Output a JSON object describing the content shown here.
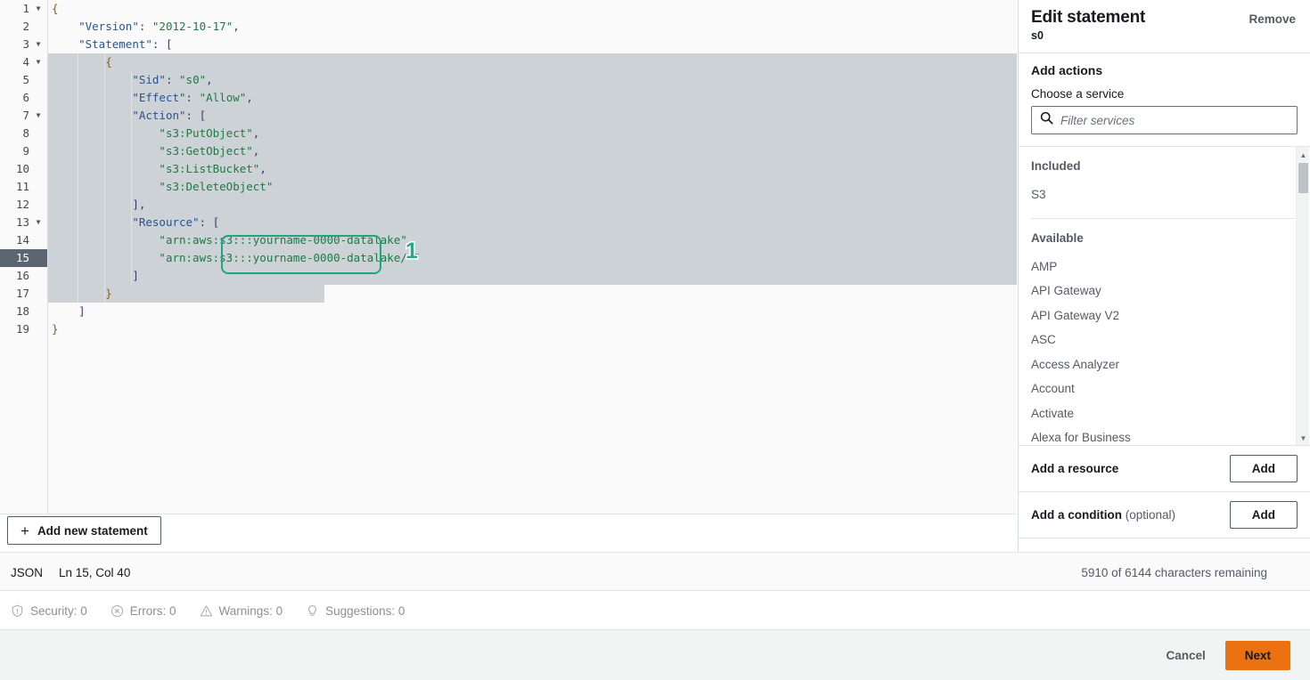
{
  "editor": {
    "language": "JSON",
    "cursor": "Ln 15, Col 40",
    "active_line": 15,
    "lines": [
      {
        "n": 1,
        "fold": true,
        "tokens": [
          {
            "t": "brace",
            "v": "{"
          }
        ]
      },
      {
        "n": 2,
        "fold": false,
        "tokens": [
          {
            "t": "plain",
            "v": "    "
          },
          {
            "t": "key",
            "v": "\"Version\""
          },
          {
            "t": "pun",
            "v": ": "
          },
          {
            "t": "str",
            "v": "\"2012-10-17\""
          },
          {
            "t": "pun",
            "v": ","
          }
        ]
      },
      {
        "n": 3,
        "fold": true,
        "tokens": [
          {
            "t": "plain",
            "v": "    "
          },
          {
            "t": "key",
            "v": "\"Statement\""
          },
          {
            "t": "pun",
            "v": ": ["
          }
        ]
      },
      {
        "n": 4,
        "fold": true,
        "tokens": [
          {
            "t": "plain",
            "v": "        "
          },
          {
            "t": "brace",
            "v": "{"
          }
        ]
      },
      {
        "n": 5,
        "fold": false,
        "tokens": [
          {
            "t": "plain",
            "v": "            "
          },
          {
            "t": "key",
            "v": "\"Sid\""
          },
          {
            "t": "pun",
            "v": ": "
          },
          {
            "t": "str",
            "v": "\"s0\""
          },
          {
            "t": "pun",
            "v": ","
          }
        ]
      },
      {
        "n": 6,
        "fold": false,
        "tokens": [
          {
            "t": "plain",
            "v": "            "
          },
          {
            "t": "key",
            "v": "\"Effect\""
          },
          {
            "t": "pun",
            "v": ": "
          },
          {
            "t": "str",
            "v": "\"Allow\""
          },
          {
            "t": "pun",
            "v": ","
          }
        ]
      },
      {
        "n": 7,
        "fold": true,
        "tokens": [
          {
            "t": "plain",
            "v": "            "
          },
          {
            "t": "key",
            "v": "\"Action\""
          },
          {
            "t": "pun",
            "v": ": ["
          }
        ]
      },
      {
        "n": 8,
        "fold": false,
        "tokens": [
          {
            "t": "plain",
            "v": "                "
          },
          {
            "t": "str",
            "v": "\"s3:PutObject\""
          },
          {
            "t": "pun",
            "v": ","
          }
        ]
      },
      {
        "n": 9,
        "fold": false,
        "tokens": [
          {
            "t": "plain",
            "v": "                "
          },
          {
            "t": "str",
            "v": "\"s3:GetObject\""
          },
          {
            "t": "pun",
            "v": ","
          }
        ]
      },
      {
        "n": 10,
        "fold": false,
        "tokens": [
          {
            "t": "plain",
            "v": "                "
          },
          {
            "t": "str",
            "v": "\"s3:ListBucket\""
          },
          {
            "t": "pun",
            "v": ","
          }
        ]
      },
      {
        "n": 11,
        "fold": false,
        "tokens": [
          {
            "t": "plain",
            "v": "                "
          },
          {
            "t": "str",
            "v": "\"s3:DeleteObject\""
          }
        ]
      },
      {
        "n": 12,
        "fold": false,
        "tokens": [
          {
            "t": "plain",
            "v": "            "
          },
          {
            "t": "pun",
            "v": "],"
          }
        ]
      },
      {
        "n": 13,
        "fold": true,
        "tokens": [
          {
            "t": "plain",
            "v": "            "
          },
          {
            "t": "key",
            "v": "\"Resource\""
          },
          {
            "t": "pun",
            "v": ": ["
          }
        ]
      },
      {
        "n": 14,
        "fold": false,
        "tokens": [
          {
            "t": "plain",
            "v": "                "
          },
          {
            "t": "str",
            "v": "\"arn:aws:s3:::yourname-0000-datalake\""
          },
          {
            "t": "pun",
            "v": ","
          }
        ]
      },
      {
        "n": 15,
        "fold": false,
        "tokens": [
          {
            "t": "plain",
            "v": "                "
          },
          {
            "t": "str",
            "v": "\"arn:aws:s3:::yourname-0000-datalake/*\""
          }
        ]
      },
      {
        "n": 16,
        "fold": false,
        "tokens": [
          {
            "t": "plain",
            "v": "            "
          },
          {
            "t": "pun",
            "v": "]"
          }
        ]
      },
      {
        "n": 17,
        "fold": false,
        "tokens": [
          {
            "t": "plain",
            "v": "        "
          },
          {
            "t": "brace",
            "v": "}"
          }
        ]
      },
      {
        "n": 18,
        "fold": false,
        "tokens": [
          {
            "t": "plain",
            "v": "    "
          },
          {
            "t": "pun",
            "v": "]"
          }
        ]
      },
      {
        "n": 19,
        "fold": false,
        "tokens": [
          {
            "t": "brace",
            "v": "}"
          }
        ]
      }
    ],
    "annotation": {
      "number": "1",
      "color": "#17b08a"
    },
    "add_statement_label": "Add new statement",
    "char_count": "5910 of 6144 characters remaining"
  },
  "lint": {
    "security": "Security: 0",
    "errors": "Errors: 0",
    "warnings": "Warnings: 0",
    "suggestions": "Suggestions: 0"
  },
  "footer": {
    "cancel": "Cancel",
    "next": "Next",
    "next_color": "#ec7211"
  },
  "panel": {
    "title": "Edit statement",
    "subtitle": "s0",
    "remove": "Remove",
    "add_actions": "Add actions",
    "choose_service": "Choose a service",
    "filter_placeholder": "Filter services",
    "filter_value": "",
    "included_header": "Included",
    "included": [
      "S3"
    ],
    "available_header": "Available",
    "available": [
      "AMP",
      "API Gateway",
      "API Gateway V2",
      "ASC",
      "Access Analyzer",
      "Account",
      "Activate",
      "Alexa for Business"
    ],
    "resource_row": {
      "label": "Add a resource",
      "button": "Add"
    },
    "condition_row": {
      "label": "Add a condition ",
      "optional": "(optional)",
      "button": "Add"
    }
  }
}
